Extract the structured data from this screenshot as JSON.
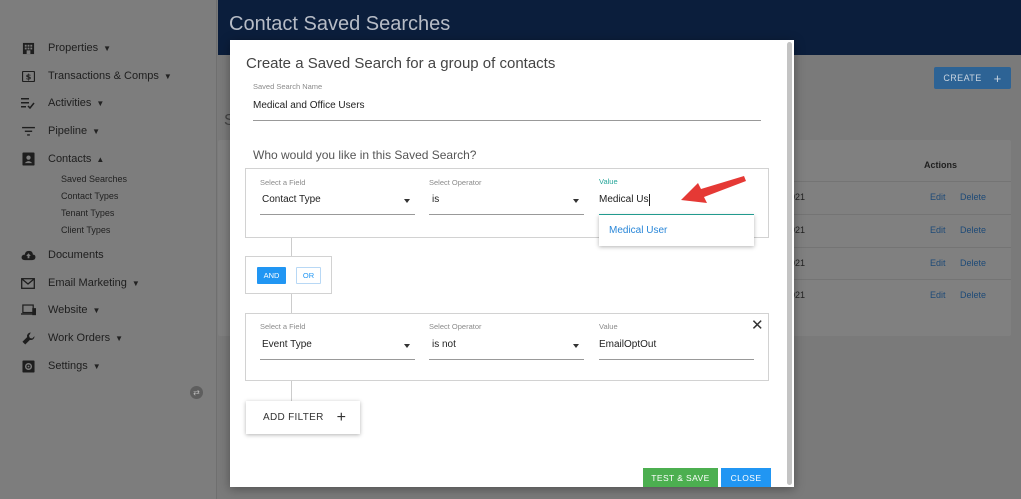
{
  "sidebar": {
    "items": [
      {
        "label": "Properties",
        "icon": "building-icon"
      },
      {
        "label": "Transactions & Comps",
        "icon": "dollar-icon"
      },
      {
        "label": "Activities",
        "icon": "checklist-icon"
      },
      {
        "label": "Pipeline",
        "icon": "filter-icon"
      },
      {
        "label": "Contacts",
        "icon": "contacts-icon"
      },
      {
        "label": "Documents",
        "icon": "cloud-upload-icon"
      },
      {
        "label": "Email Marketing",
        "icon": "mail-icon"
      },
      {
        "label": "Website",
        "icon": "devices-icon"
      },
      {
        "label": "Work Orders",
        "icon": "wrench-icon"
      },
      {
        "label": "Settings",
        "icon": "gear-icon"
      }
    ],
    "contacts_sub": [
      "Saved Searches",
      "Contact Types",
      "Tenant Types",
      "Client Types"
    ]
  },
  "header": {
    "title": "Contact Saved Searches"
  },
  "create_button": {
    "label": "CREATE",
    "plus": "+"
  },
  "bg_table": {
    "s_fragment": "S",
    "actions_header": "Actions",
    "date_fragments": [
      "021",
      "021",
      "021",
      "021"
    ],
    "edit_label": "Edit",
    "delete_label": "Delete"
  },
  "modal": {
    "title": "Create a Saved Search for a group of contacts",
    "name_label": "Saved Search Name",
    "name_value": "Medical and Office Users",
    "question": "Who would you like in this Saved Search?",
    "field_label": "Select a Field",
    "operator_label": "Select Operator",
    "value_label": "Value",
    "filter1": {
      "field": "Contact Type",
      "operator": "is",
      "value": "Medical Us"
    },
    "suggestion": "Medical User",
    "and_label": "AND",
    "or_label": "OR",
    "filter2": {
      "field": "Event Type",
      "operator": "is not",
      "value": "EmailOptOut"
    },
    "close_x": "✕",
    "add_filter_label": "ADD FILTER",
    "add_filter_plus": "+",
    "test_save_label": "TEST & SAVE",
    "close_label": "CLOSE"
  },
  "colors": {
    "header_bg": "#0b1e3c",
    "primary": "#2196f3",
    "success": "#4caf50",
    "value_label_teal": "#26a69a",
    "annotation_arrow": "#e53935"
  }
}
